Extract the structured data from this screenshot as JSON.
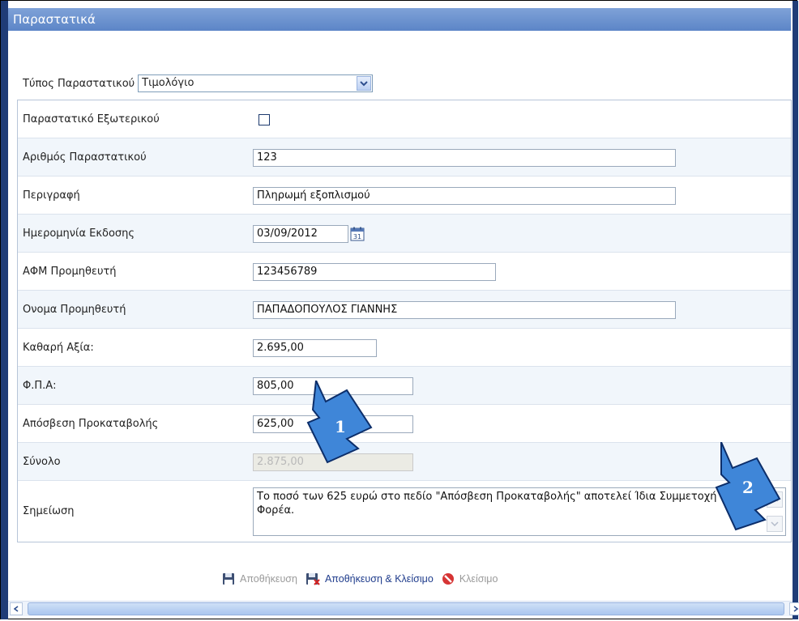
{
  "window": {
    "title": "Παραστατικά"
  },
  "doc_type": {
    "label": "Τύπος Παραστατικού",
    "selected": "Τιμολόγιο"
  },
  "form": {
    "external_label": "Παραστατικό Εξωτερικού",
    "number_label": "Αριθμός Παραστατικού",
    "number_value": "123",
    "description_label": "Περιγραφή",
    "description_value": "Πληρωμή εξοπλισμού",
    "issue_date_label": "Ημερομηνία Εκδοσης",
    "issue_date_value": "03/09/2012",
    "vat_id_label": "ΑΦΜ Προμηθευτή",
    "vat_id_value": "123456789",
    "supplier_name_label": "Ονομα Προμηθευτή",
    "supplier_name_value": "ΠΑΠΑΔΟΠΟΥΛΟΣ ΓΙΑΝΝΗΣ",
    "net_value_label": "Καθαρή Αξία:",
    "net_value_value": "2.695,00",
    "vat_label": "Φ.Π.Α:",
    "vat_value": "805,00",
    "advance_label": "Απόσβεση Προκαταβολής",
    "advance_value": "625,00",
    "total_label": "Σύνολο",
    "total_value": "2.875,00",
    "note_label": "Σημείωση",
    "note_value": "Το ποσό των 625 ευρώ στο πεδίο \"Απόσβεση Προκαταβολής\" αποτελεί Ίδια Συμμετοχή του Φορέα."
  },
  "actions": {
    "save": "Αποθήκευση",
    "save_close": "Αποθήκευση & Κλείσιμο",
    "close": "Κλείσιμο"
  },
  "callouts": {
    "first": "1",
    "second": "2"
  },
  "colors": {
    "title_bar": "#6b93d2",
    "frame": "#1f3c77",
    "callout": "#3f86d8"
  }
}
